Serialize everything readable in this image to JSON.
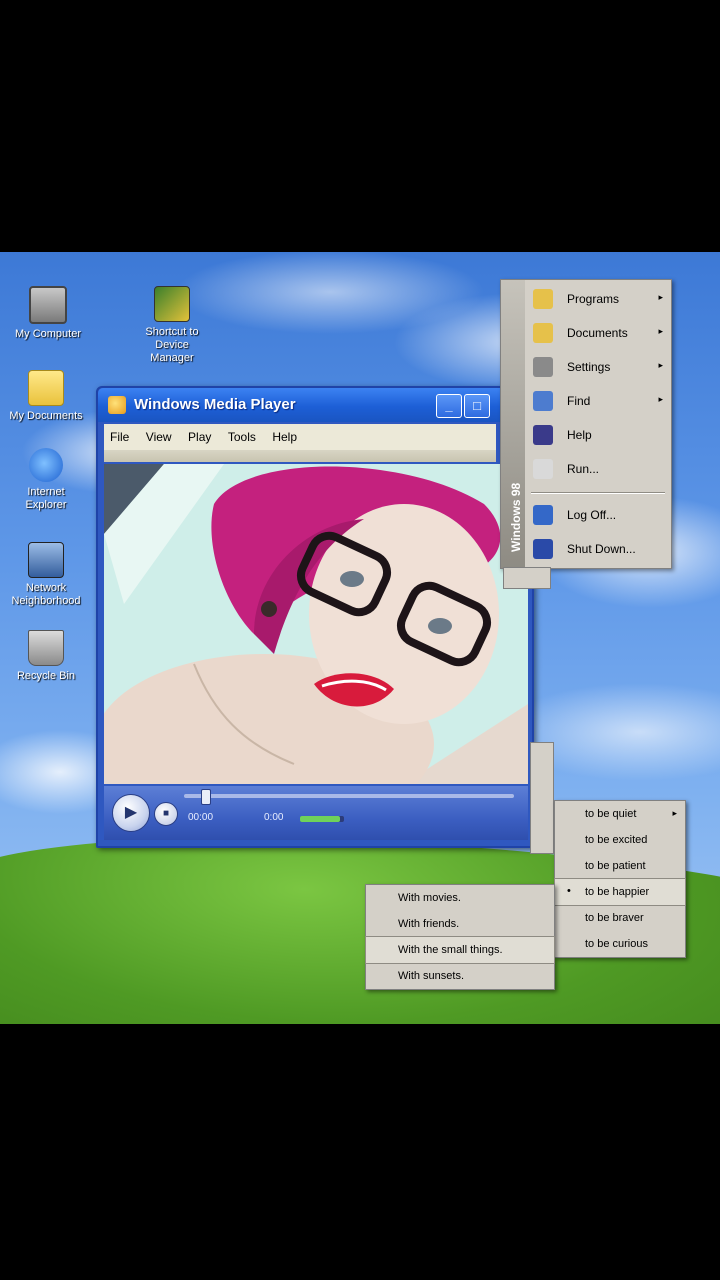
{
  "desktop": {
    "icons": [
      {
        "label": "My Computer",
        "icon": "computer-icon"
      },
      {
        "label": "Shortcut to Device Manager",
        "icon": "device-manager-icon"
      },
      {
        "label": "My Documents",
        "icon": "folder-icon"
      },
      {
        "label": "Internet Explorer",
        "icon": "internet-explorer-icon"
      },
      {
        "label": "Network Neighborhood",
        "icon": "network-icon"
      },
      {
        "label": "Recycle Bin",
        "icon": "recycle-bin-icon"
      }
    ]
  },
  "wmp": {
    "title": "Windows Media Player",
    "menu": [
      "File",
      "View",
      "Play",
      "Tools",
      "Help"
    ],
    "time": "00:00",
    "status": "0:00",
    "seek_fraction": 0.05,
    "volume_fraction": 0.9
  },
  "start_menu": {
    "band_text": "Windows 98",
    "items": [
      {
        "label": "Programs",
        "has_sub": true,
        "icon": "programs-icon"
      },
      {
        "label": "Documents",
        "has_sub": true,
        "icon": "documents-icon"
      },
      {
        "label": "Settings",
        "has_sub": true,
        "icon": "settings-icon"
      },
      {
        "label": "Find",
        "has_sub": true,
        "icon": "find-icon"
      },
      {
        "label": "Help",
        "has_sub": false,
        "icon": "help-icon"
      },
      {
        "label": "Run...",
        "has_sub": false,
        "icon": "run-icon"
      },
      {
        "label": "Log Off...",
        "has_sub": false,
        "icon": "log-off-icon"
      },
      {
        "label": "Shut Down...",
        "has_sub": false,
        "icon": "shut-down-icon"
      }
    ]
  },
  "submenu_to_be": [
    {
      "label": "to be quiet",
      "has_sub": true
    },
    {
      "label": "to be excited",
      "has_sub": false
    },
    {
      "label": "to be patient",
      "has_sub": false
    },
    {
      "label": "to be happier",
      "has_sub": false,
      "selected": true
    },
    {
      "label": "to be braver",
      "has_sub": false
    },
    {
      "label": "to be curious",
      "has_sub": false
    }
  ],
  "submenu_with": [
    {
      "label": "With movies.",
      "selected": false
    },
    {
      "label": "With friends.",
      "selected": false
    },
    {
      "label": "With the small things.",
      "selected": true
    },
    {
      "label": "With sunsets.",
      "selected": false
    }
  ]
}
